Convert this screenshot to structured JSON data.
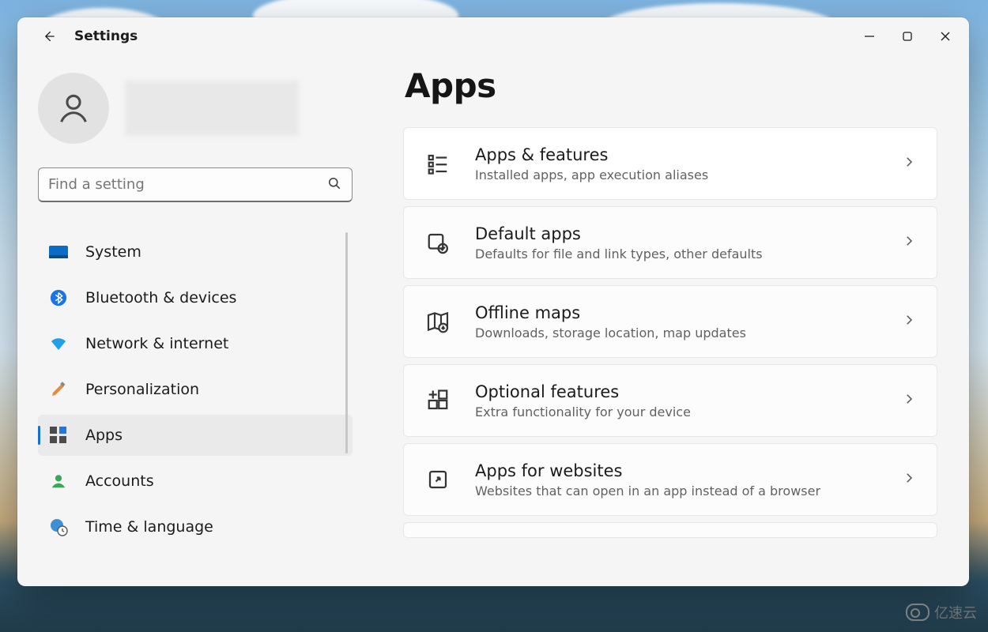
{
  "app": {
    "title": "Settings"
  },
  "search": {
    "placeholder": "Find a setting"
  },
  "sidebar": {
    "items": [
      {
        "label": "System"
      },
      {
        "label": "Bluetooth & devices"
      },
      {
        "label": "Network & internet"
      },
      {
        "label": "Personalization"
      },
      {
        "label": "Apps"
      },
      {
        "label": "Accounts"
      },
      {
        "label": "Time & language"
      }
    ],
    "selected_index": 4
  },
  "page": {
    "title": "Apps"
  },
  "cards": [
    {
      "title": "Apps & features",
      "sub": "Installed apps, app execution aliases"
    },
    {
      "title": "Default apps",
      "sub": "Defaults for file and link types, other defaults"
    },
    {
      "title": "Offline maps",
      "sub": "Downloads, storage location, map updates"
    },
    {
      "title": "Optional features",
      "sub": "Extra functionality for your device"
    },
    {
      "title": "Apps for websites",
      "sub": "Websites that can open in an app instead of a browser"
    }
  ],
  "watermark": {
    "text": "亿速云"
  }
}
